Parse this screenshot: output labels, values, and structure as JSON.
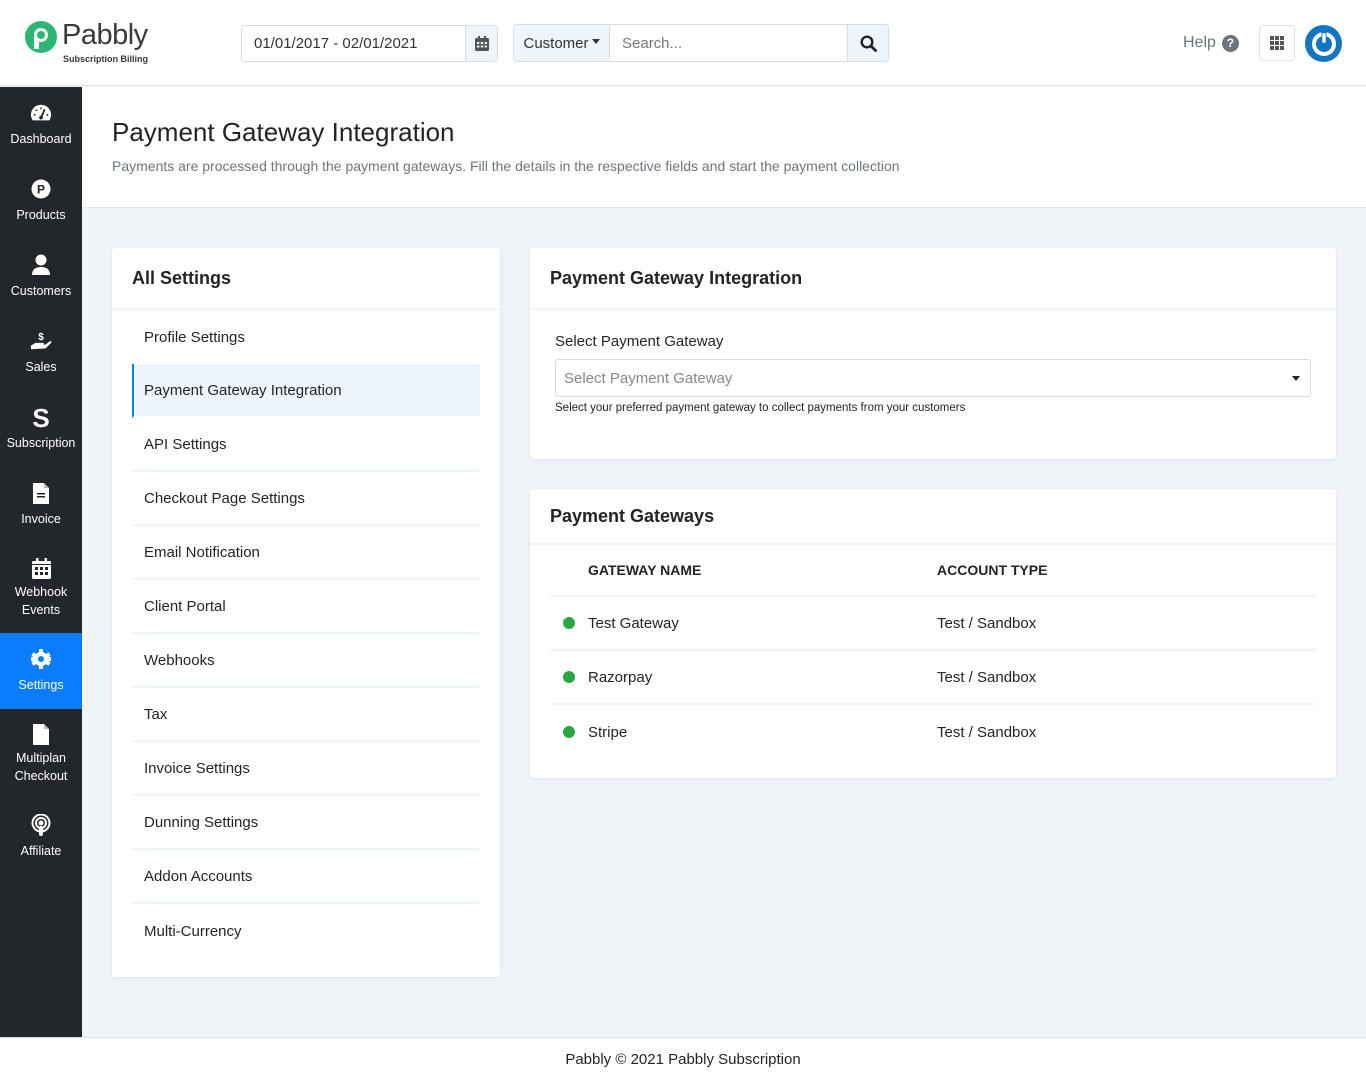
{
  "header": {
    "logo_text": "Pabbly",
    "logo_subtext": "Subscription Billing",
    "date_range": "01/01/2017 - 02/01/2021",
    "search_type": "Customer",
    "search_placeholder": "Search...",
    "help_label": "Help"
  },
  "sidebar": {
    "items": [
      {
        "label": "Dashboard",
        "icon": "dashboard-icon"
      },
      {
        "label": "Products",
        "icon": "products-icon"
      },
      {
        "label": "Customers",
        "icon": "user-icon"
      },
      {
        "label": "Sales",
        "icon": "sales-icon"
      },
      {
        "label": "Subscription",
        "icon": "subscription-icon"
      },
      {
        "label": "Invoice",
        "icon": "invoice-icon"
      },
      {
        "label": "Webhook Events",
        "icon": "calendar-icon"
      },
      {
        "label": "Settings",
        "icon": "gear-icon",
        "active": true
      },
      {
        "label": "Multiplan Checkout",
        "icon": "file-icon"
      },
      {
        "label": "Affiliate",
        "icon": "podcast-icon"
      }
    ]
  },
  "page": {
    "title": "Payment Gateway Integration",
    "subtitle": "Payments are processed through the payment gateways. Fill the details in the respective fields and start the payment collection"
  },
  "settings": {
    "title": "All Settings",
    "items": [
      {
        "label": "Profile Settings"
      },
      {
        "label": "Payment Gateway Integration",
        "active": true
      },
      {
        "label": "API Settings"
      },
      {
        "label": "Checkout Page Settings"
      },
      {
        "label": "Email Notification"
      },
      {
        "label": "Client Portal"
      },
      {
        "label": "Webhooks"
      },
      {
        "label": "Tax"
      },
      {
        "label": "Invoice Settings"
      },
      {
        "label": "Dunning Settings"
      },
      {
        "label": "Addon Accounts"
      },
      {
        "label": "Multi-Currency"
      }
    ]
  },
  "integration": {
    "title": "Payment Gateway Integration",
    "field_label": "Select Payment Gateway",
    "select_placeholder": "Select Payment Gateway",
    "field_help": "Select your preferred payment gateway to collect payments from your customers"
  },
  "gateways": {
    "title": "Payment Gateways",
    "columns": [
      "GATEWAY NAME",
      "ACCOUNT TYPE"
    ],
    "rows": [
      {
        "name": "Test Gateway",
        "type": "Test / Sandbox",
        "status": "active"
      },
      {
        "name": "Razorpay",
        "type": "Test / Sandbox",
        "status": "active"
      },
      {
        "name": "Stripe",
        "type": "Test / Sandbox",
        "status": "active"
      }
    ],
    "status_color": "#28a745"
  },
  "footer": {
    "text": "Pabbly © 2021 Pabbly Subscription"
  },
  "colors": {
    "accent": "#0a7cff",
    "sidebar_bg": "#23262b",
    "brand_green": "#2bb673",
    "power_blue": "#1374c1"
  }
}
